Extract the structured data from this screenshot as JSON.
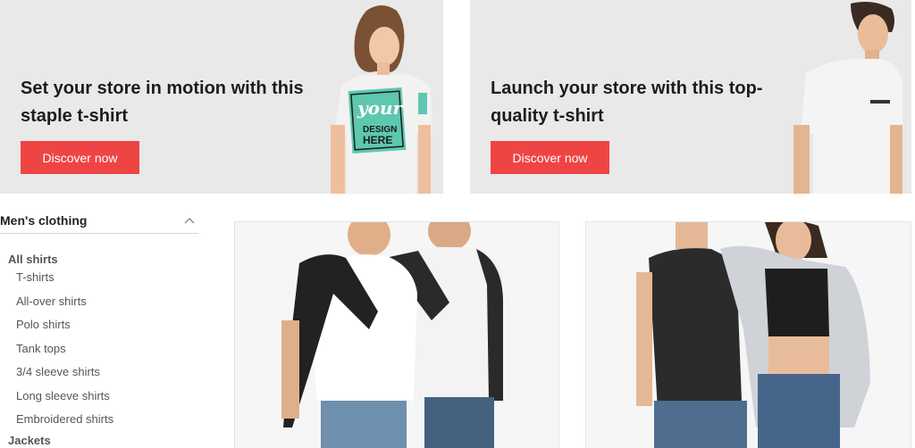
{
  "banners": [
    {
      "heading": "Set your store in motion with this staple t-shirt",
      "button_label": "Discover now",
      "shirt_print": [
        "your",
        "DESIGN",
        "HERE"
      ]
    },
    {
      "heading": "Launch your store with this top-quality t-shirt",
      "button_label": "Discover now"
    }
  ],
  "sidebar": {
    "title": "Men's clothing",
    "section": "All shirts",
    "items": [
      "T-shirts",
      "All-over shirts",
      "Polo shirts",
      "Tank tops",
      "3/4 sleeve shirts",
      "Long sleeve shirts",
      "Embroidered shirts"
    ],
    "next_section": "Jackets"
  },
  "colors": {
    "accent": "#ef4444",
    "banner_bg": "#e9e9e9",
    "print_teal": "#5ec7b0"
  }
}
